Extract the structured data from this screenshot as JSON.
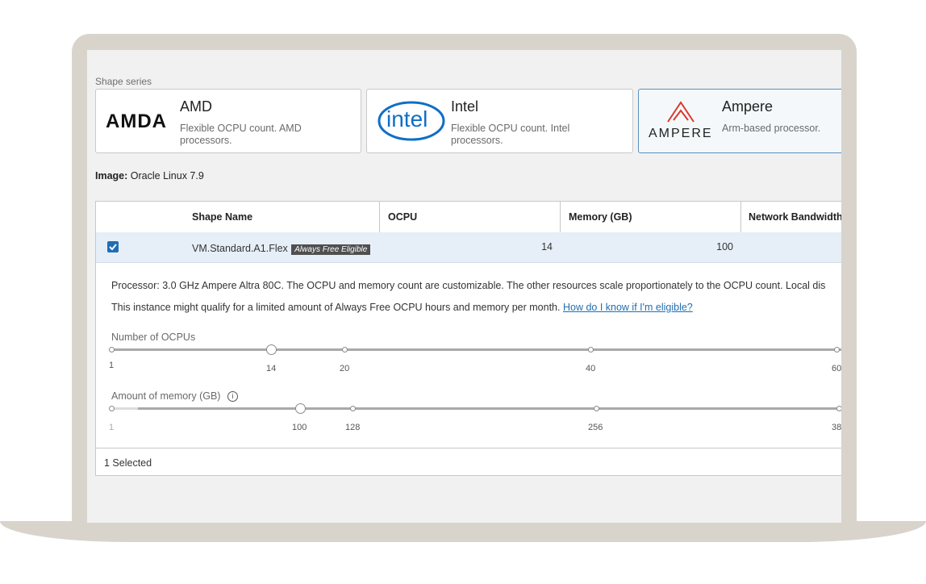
{
  "shape_series_label": "Shape series",
  "cards": [
    {
      "logo": "AMDA",
      "title": "AMD",
      "desc": "Flexible OCPU count. AMD processors."
    },
    {
      "logo": "intel",
      "title": "Intel",
      "desc": "Flexible OCPU count. Intel processors."
    },
    {
      "logo": "AMPERE",
      "title": "Ampere",
      "desc": "Arm-based processor."
    }
  ],
  "image": {
    "label": "Image:",
    "value": "Oracle Linux 7.9"
  },
  "table": {
    "headers": [
      "Shape Name",
      "OCPU",
      "Memory (GB)",
      "Network Bandwidth"
    ],
    "row": {
      "shape": "VM.Standard.A1.Flex",
      "badge": "Always Free Eligible",
      "ocpu": "14",
      "memory": "100"
    }
  },
  "details": {
    "processor": "Processor: 3.0 GHz Ampere Altra 80C. The OCPU and memory count are customizable. The other resources scale proportionately to the OCPU count. Local dis",
    "free_text": "This instance might qualify for a limited amount of Always Free OCPU hours and memory per month.",
    "free_link": "How do I know if I'm eligible?"
  },
  "ocpu_slider": {
    "label": "Number of OCPUs",
    "value": 14,
    "ticks": [
      "1",
      "14",
      "20",
      "40",
      "60"
    ]
  },
  "memory_slider": {
    "label": "Amount of memory (GB)",
    "info_icon": "i",
    "value": 100,
    "ticks": [
      "1",
      "100",
      "128",
      "256",
      "38"
    ]
  },
  "footer": {
    "selected": "1 Selected"
  },
  "colors": {
    "accent": "#1f6eb4",
    "amd_logo": "#111111",
    "intel_logo": "#0f6fc6",
    "ampere_logo": "#d93a2b"
  }
}
